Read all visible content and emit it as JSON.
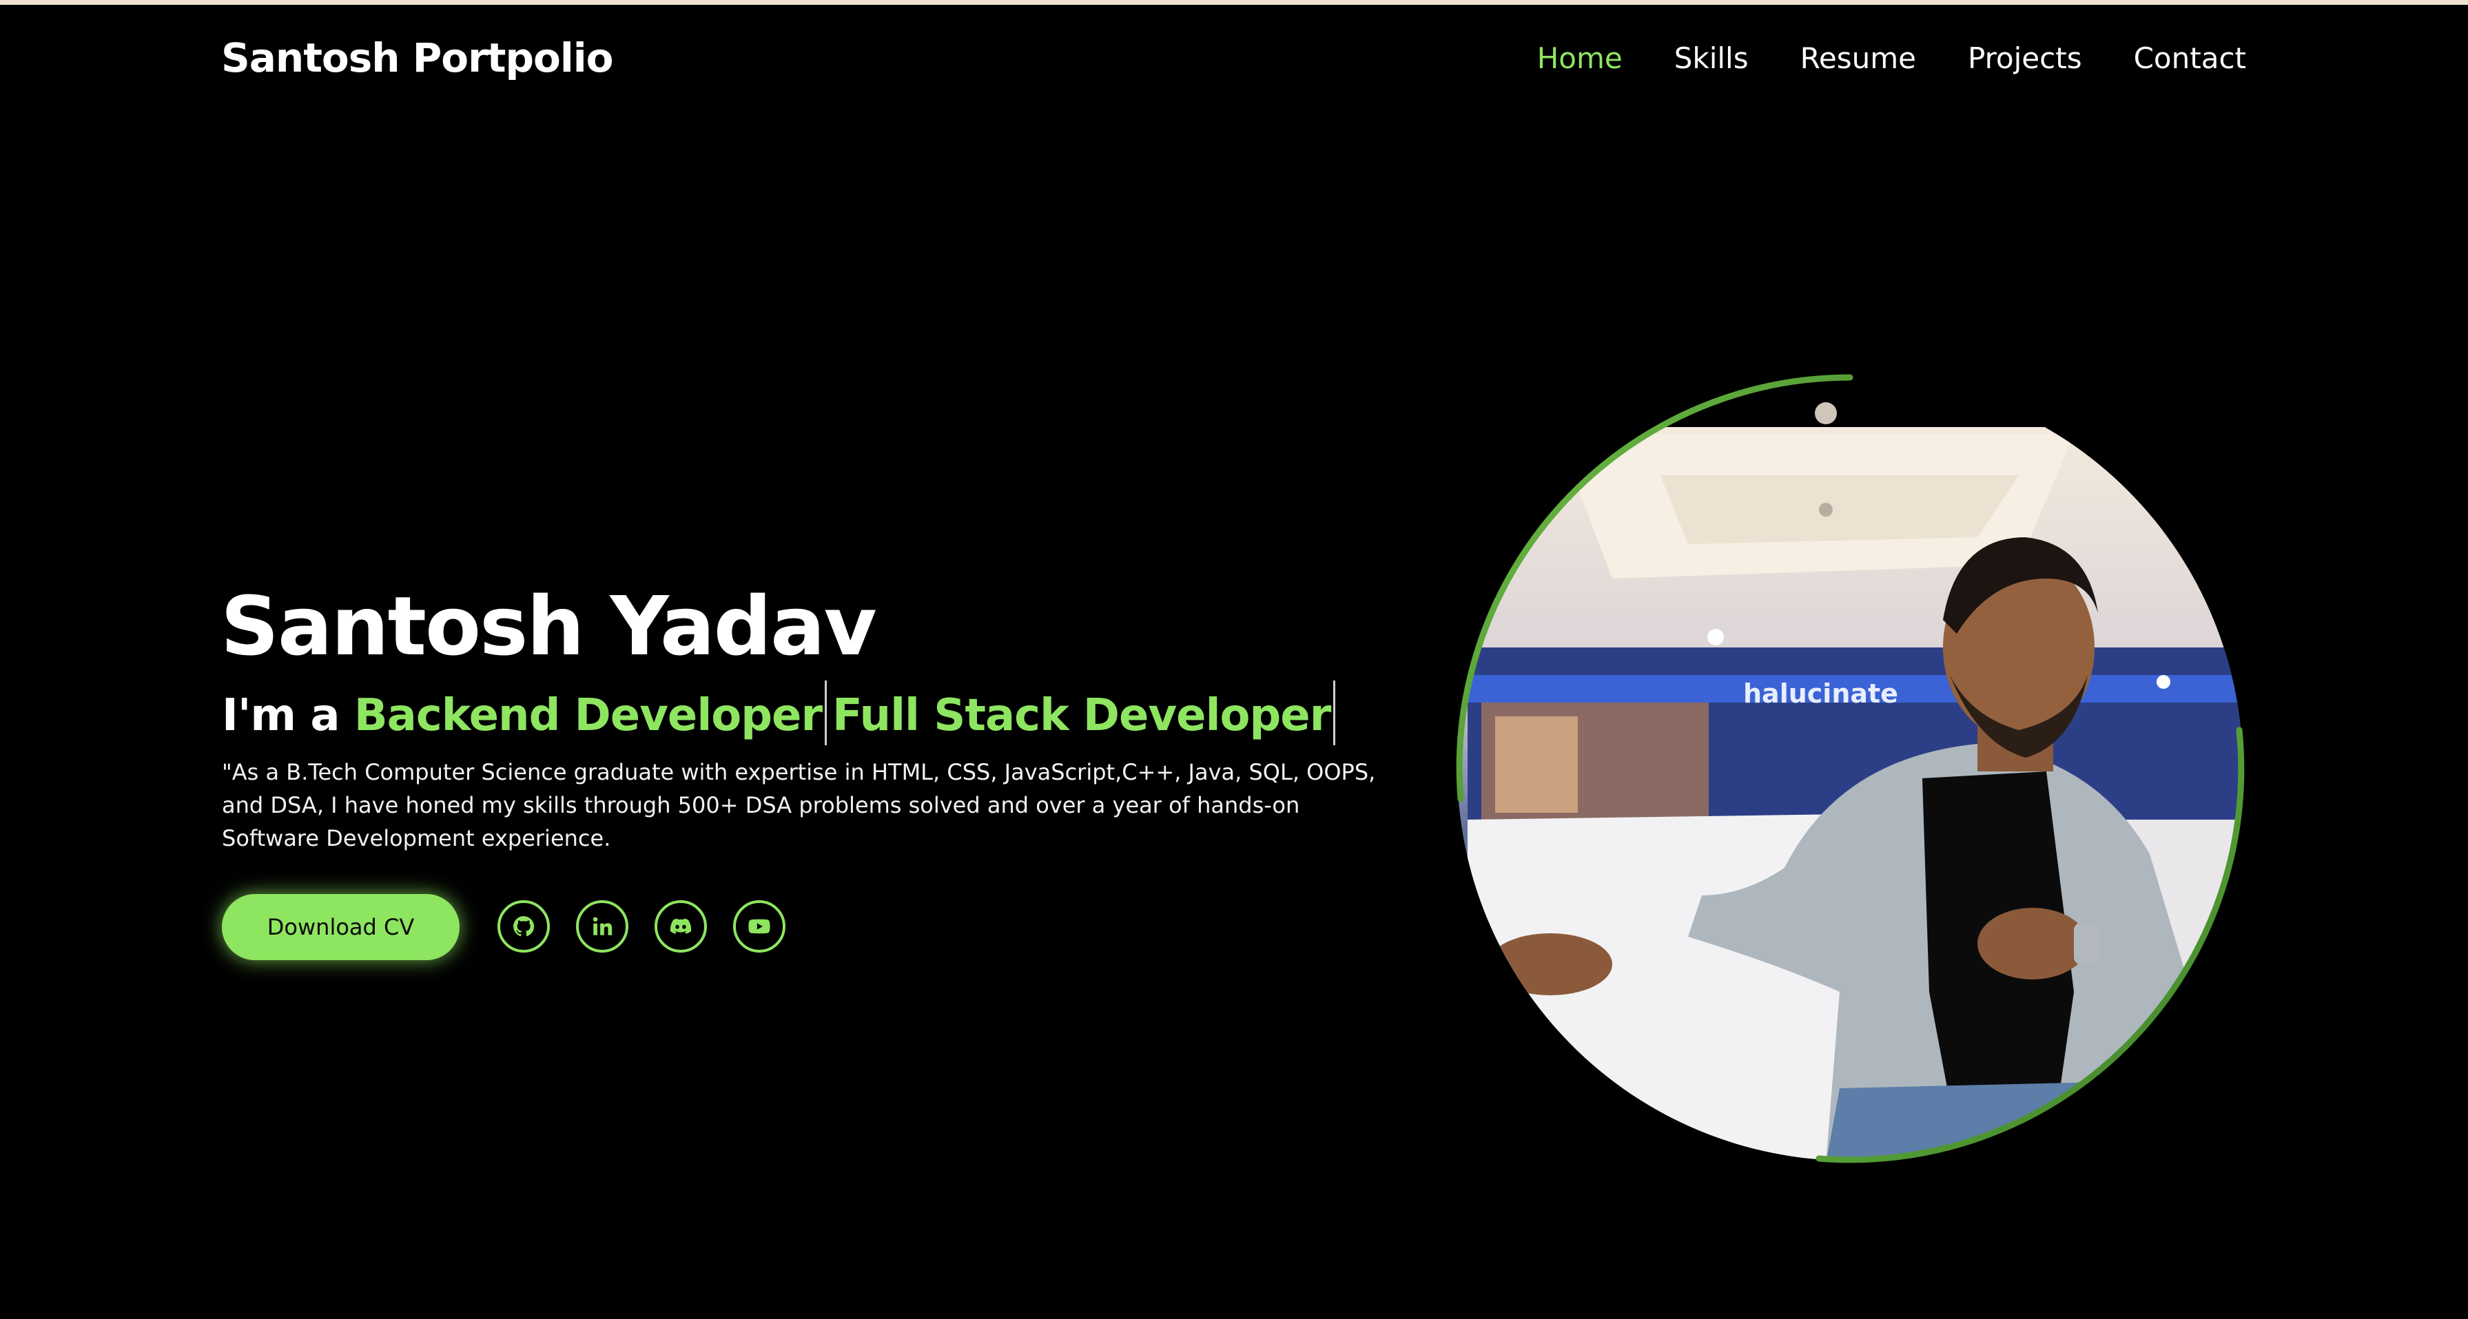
{
  "brand": {
    "title": "Santosh Portpolio"
  },
  "nav": {
    "items": [
      {
        "label": "Home",
        "active": true
      },
      {
        "label": "Skills"
      },
      {
        "label": "Resume"
      },
      {
        "label": "Projects"
      },
      {
        "label": "Contact"
      }
    ]
  },
  "hero": {
    "name": "Santosh Yadav",
    "role_prefix": "I'm a ",
    "role_text_1": "Backend Developer",
    "role_text_2": "Full Stack Developer",
    "description": "\"As a B.Tech Computer Science graduate with expertise in HTML, CSS, JavaScript,C++, Java, SQL, OOPS, and DSA, I have honed my skills through 500+ DSA problems solved and over a year of hands-on Software Development experience.",
    "cv_button": "Download CV",
    "photo_caption": "halucinate"
  },
  "socials": [
    {
      "icon": "github-icon"
    },
    {
      "icon": "linkedin-icon"
    },
    {
      "icon": "discord-icon"
    },
    {
      "icon": "youtube-icon"
    }
  ],
  "colors": {
    "background": "#000000",
    "accent": "#8ee560",
    "text": "#ffffff",
    "top_strip": "#efe3cf"
  }
}
